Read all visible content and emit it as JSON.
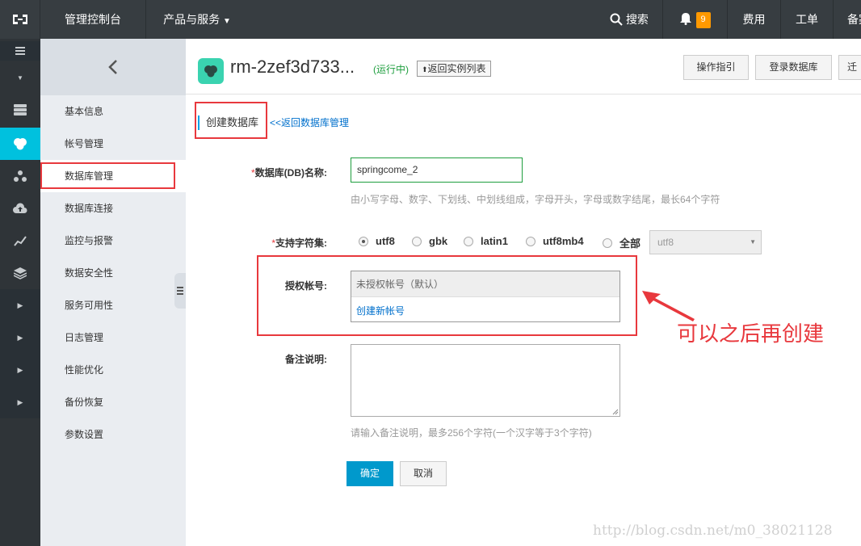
{
  "topbar": {
    "console": "管理控制台",
    "products": "产品与服务",
    "search": "搜索",
    "notify_count": "9",
    "billing": "费用",
    "tickets": "工单",
    "record": "备案"
  },
  "sidebar": {
    "items": [
      {
        "label": "基本信息"
      },
      {
        "label": "帐号管理"
      },
      {
        "label": "数据库管理"
      },
      {
        "label": "数据库连接"
      },
      {
        "label": "监控与报警"
      },
      {
        "label": "数据安全性"
      },
      {
        "label": "服务可用性"
      },
      {
        "label": "日志管理"
      },
      {
        "label": "性能优化"
      },
      {
        "label": "备份恢复"
      },
      {
        "label": "参数设置"
      }
    ]
  },
  "instance": {
    "name": "rm-2zef3d733...",
    "status": "(运行中)",
    "back_to_list": "返回实例列表",
    "guide_btn": "操作指引",
    "login_btn": "登录数据库",
    "migrate_btn": "迁"
  },
  "page": {
    "title": "创建数据库",
    "back_link": "<<返回数据库管理"
  },
  "form": {
    "db_name_label": "数据库(DB)名称:",
    "db_name_value": "springcome_2",
    "db_name_hint": "由小写字母、数字、下划线、中划线组成，字母开头，字母或数字结尾，最长64个字符",
    "charset_label": "支持字符集:",
    "charset_options": [
      "utf8",
      "gbk",
      "latin1",
      "utf8mb4",
      "全部"
    ],
    "charset_selected": "utf8",
    "charset_select_value": "utf8",
    "account_label": "授权帐号:",
    "account_default": "未授权帐号（默认）",
    "account_create": "创建新帐号",
    "remark_label": "备注说明:",
    "remark_hint": "请输入备注说明，最多256个字符(一个汉字等于3个字符)",
    "required_mark": "*",
    "ok_btn": "确定",
    "cancel_btn": "取消"
  },
  "annotation": {
    "text": "可以之后再创建",
    "color": "#e8383d"
  },
  "watermark": "http://blog.csdn.net/m0_38021128"
}
